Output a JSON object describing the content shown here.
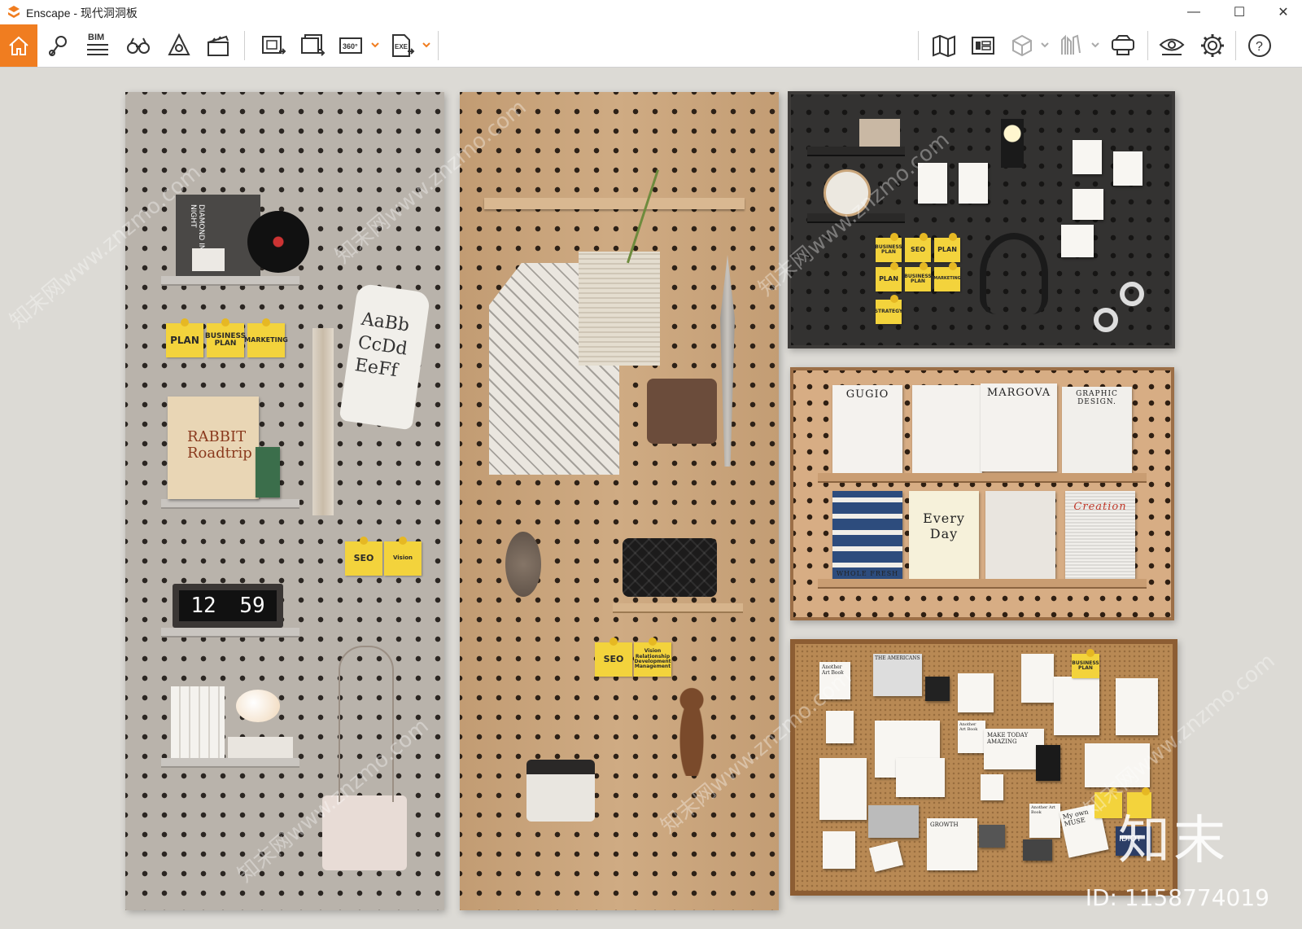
{
  "window": {
    "app_name": "Enscape",
    "title": "Enscape - 现代洞洞板",
    "controls": {
      "minimize": "—",
      "maximize": "☐",
      "close": "✕"
    }
  },
  "toolbar": {
    "accent_color": "#f07d20",
    "left_tools": [
      "home-icon",
      "pin-icon",
      "bim-icon",
      "binoculars-icon",
      "sun-icon",
      "clapperboard-icon",
      "screenshot-icon",
      "batch-render-icon",
      "panorama-360-icon",
      "export-exe-icon"
    ],
    "bim_label": "BIM",
    "panorama_label": "360°",
    "exe_label": "EXE",
    "right_tools": [
      "map-icon",
      "asset-library-icon",
      "cube-icon",
      "books-icon",
      "vr-headset-icon",
      "eye-settings-icon",
      "gear-icon",
      "help-icon"
    ],
    "help_label": "?"
  },
  "scene": {
    "grey_panel": {
      "record_cover": "DIAMOND IN THE NIGHT",
      "sticky_notes": [
        "PLAN",
        "BUSINESS PLAN",
        "MARKETING"
      ],
      "bag_text": "AaBb CcDd EeFf",
      "book_title": "RABBIT Roadtrip",
      "seo_note": "SEO",
      "clock_hour": "12",
      "clock_minute": "59"
    },
    "wood_panel": {
      "sticky_notes": [
        "SEO",
        "Vision Relationship Development Management"
      ]
    },
    "black_panel": {
      "sticky_notes": [
        "BUSINESS PLAN",
        "SEO",
        "PLAN",
        "PLAN",
        "BUSINESS PLAN",
        "MARKETING",
        "STRATEGY"
      ]
    },
    "magazine_panel": {
      "magazines_top": [
        "GUGIO",
        "",
        "MARGOVA",
        "GRAPHIC DESIGN."
      ],
      "magazines_bottom": [
        "WHOLE FRESH",
        "Every Day",
        "",
        "Creation"
      ]
    },
    "cork_panel": {
      "notes": [
        "Another Art Book",
        "THE AMERICANS",
        "Another Art Book",
        "MAKE TODAY AMAZING",
        "GROWTH",
        "Another Art Book",
        "BUSINESS PLAN",
        "My own MUSE",
        "IDIOT"
      ]
    }
  },
  "watermark": {
    "logo_text": "知末",
    "id_text": "ID: 1158774019",
    "repeat_text": "知末网www.znzmo.com"
  }
}
